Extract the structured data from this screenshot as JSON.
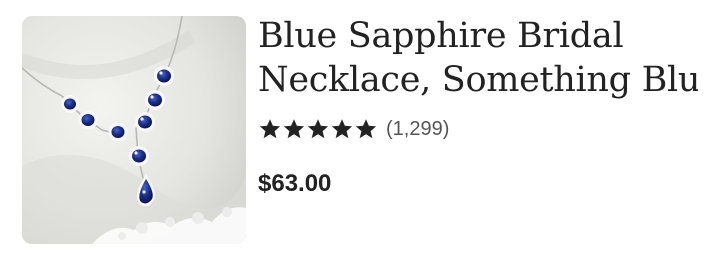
{
  "listing": {
    "title_line1": "Blue Sapphire Bridal",
    "title_line2": "Necklace, Something Blue...",
    "rating": {
      "stars": 5,
      "max_stars": 5,
      "review_count": "(1,299)"
    },
    "price": "$63.00",
    "image": {
      "subject": "silver necklace with blue sapphire teardrop stones on white lace",
      "icon": "necklace-product-photo"
    }
  },
  "colors": {
    "text": "#222222",
    "muted": "#555555",
    "star": "#222222",
    "sapphire": "#1a2f8a"
  }
}
